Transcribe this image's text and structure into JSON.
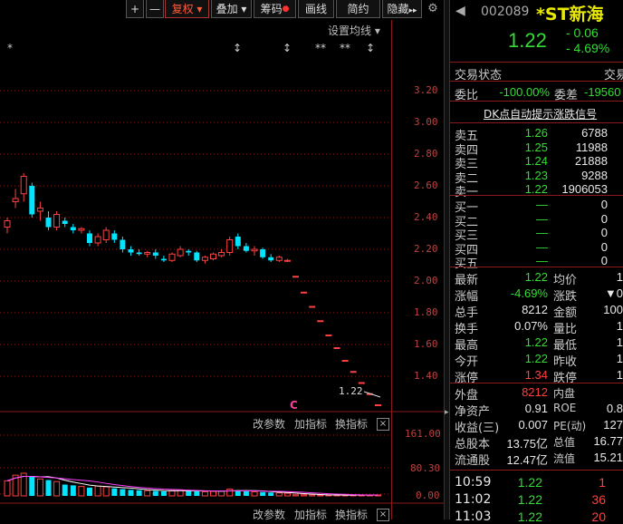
{
  "toolbar": {
    "plus": "+",
    "minus": "—",
    "fuquan": "复权",
    "diejia": "叠加",
    "chouma": "筹码",
    "huaxian": "画线",
    "jianyue": "简约",
    "yincang": "隐藏",
    "arrow": "▸▸"
  },
  "chart": {
    "settings_label": "设置均线",
    "y_ticks": [
      "3.20",
      "3.00",
      "2.80",
      "2.60",
      "2.40",
      "2.20",
      "2.00",
      "1.80",
      "1.60",
      "1.40"
    ],
    "last_price_label": "1.22",
    "marker_c": "C",
    "vol_ticks": [
      "161.00",
      "80.30",
      "0.00"
    ],
    "panel_controls": {
      "change_param": "改参数",
      "add_indicator": "加指标",
      "swap_indicator": "换指标",
      "close": "×"
    },
    "top_marks": [
      "*",
      "↕",
      "↕",
      "**",
      "**",
      "↕"
    ]
  },
  "chart_data": {
    "type": "candlestick",
    "y_range": [
      1.2,
      3.3
    ],
    "candles": [
      {
        "o": 2.34,
        "h": 2.4,
        "l": 2.3,
        "c": 2.38
      },
      {
        "o": 2.5,
        "h": 2.58,
        "l": 2.46,
        "c": 2.52
      },
      {
        "o": 2.55,
        "h": 2.68,
        "l": 2.5,
        "c": 2.66
      },
      {
        "o": 2.6,
        "h": 2.62,
        "l": 2.4,
        "c": 2.42
      },
      {
        "o": 2.44,
        "h": 2.5,
        "l": 2.38,
        "c": 2.46
      },
      {
        "o": 2.4,
        "h": 2.44,
        "l": 2.32,
        "c": 2.34
      },
      {
        "o": 2.34,
        "h": 2.44,
        "l": 2.32,
        "c": 2.42
      },
      {
        "o": 2.38,
        "h": 2.4,
        "l": 2.34,
        "c": 2.36
      },
      {
        "o": 2.34,
        "h": 2.36,
        "l": 2.3,
        "c": 2.32
      },
      {
        "o": 2.32,
        "h": 2.34,
        "l": 2.3,
        "c": 2.33
      },
      {
        "o": 2.3,
        "h": 2.32,
        "l": 2.22,
        "c": 2.24
      },
      {
        "o": 2.24,
        "h": 2.3,
        "l": 2.22,
        "c": 2.28
      },
      {
        "o": 2.26,
        "h": 2.34,
        "l": 2.24,
        "c": 2.32
      },
      {
        "o": 2.3,
        "h": 2.32,
        "l": 2.24,
        "c": 2.26
      },
      {
        "o": 2.26,
        "h": 2.28,
        "l": 2.18,
        "c": 2.2
      },
      {
        "o": 2.2,
        "h": 2.22,
        "l": 2.16,
        "c": 2.18
      },
      {
        "o": 2.18,
        "h": 2.2,
        "l": 2.16,
        "c": 2.17
      },
      {
        "o": 2.17,
        "h": 2.19,
        "l": 2.15,
        "c": 2.18
      },
      {
        "o": 2.18,
        "h": 2.2,
        "l": 2.14,
        "c": 2.16
      },
      {
        "o": 2.14,
        "h": 2.16,
        "l": 2.12,
        "c": 2.13
      },
      {
        "o": 2.13,
        "h": 2.18,
        "l": 2.12,
        "c": 2.17
      },
      {
        "o": 2.16,
        "h": 2.22,
        "l": 2.15,
        "c": 2.2
      },
      {
        "o": 2.19,
        "h": 2.2,
        "l": 2.16,
        "c": 2.18
      },
      {
        "o": 2.18,
        "h": 2.19,
        "l": 2.12,
        "c": 2.13
      },
      {
        "o": 2.13,
        "h": 2.16,
        "l": 2.11,
        "c": 2.15
      },
      {
        "o": 2.14,
        "h": 2.18,
        "l": 2.13,
        "c": 2.17
      },
      {
        "o": 2.16,
        "h": 2.2,
        "l": 2.15,
        "c": 2.18
      },
      {
        "o": 2.18,
        "h": 2.28,
        "l": 2.16,
        "c": 2.26
      },
      {
        "o": 2.28,
        "h": 2.3,
        "l": 2.2,
        "c": 2.22
      },
      {
        "o": 2.22,
        "h": 2.24,
        "l": 2.18,
        "c": 2.19
      },
      {
        "o": 2.19,
        "h": 2.22,
        "l": 2.16,
        "c": 2.2
      },
      {
        "o": 2.2,
        "h": 2.21,
        "l": 2.14,
        "c": 2.15
      },
      {
        "o": 2.15,
        "h": 2.17,
        "l": 2.12,
        "c": 2.13
      },
      {
        "o": 2.13,
        "h": 2.16,
        "l": 2.12,
        "c": 2.15
      },
      {
        "o": 2.13,
        "h": 2.14,
        "l": 2.12,
        "c": 2.13
      },
      {
        "o": 2.03,
        "h": 2.03,
        "l": 2.03,
        "c": 2.03
      },
      {
        "o": 1.93,
        "h": 1.93,
        "l": 1.93,
        "c": 1.93
      },
      {
        "o": 1.84,
        "h": 1.84,
        "l": 1.84,
        "c": 1.84
      },
      {
        "o": 1.75,
        "h": 1.75,
        "l": 1.75,
        "c": 1.75
      },
      {
        "o": 1.66,
        "h": 1.66,
        "l": 1.66,
        "c": 1.66
      },
      {
        "o": 1.58,
        "h": 1.58,
        "l": 1.58,
        "c": 1.58
      },
      {
        "o": 1.5,
        "h": 1.5,
        "l": 1.5,
        "c": 1.5
      },
      {
        "o": 1.43,
        "h": 1.43,
        "l": 1.43,
        "c": 1.43
      },
      {
        "o": 1.36,
        "h": 1.36,
        "l": 1.36,
        "c": 1.36
      },
      {
        "o": 1.29,
        "h": 1.29,
        "l": 1.29,
        "c": 1.29
      },
      {
        "o": 1.22,
        "h": 1.22,
        "l": 1.22,
        "c": 1.22
      }
    ],
    "volume_range": [
      0,
      161.0
    ],
    "volumes": [
      40,
      55,
      60,
      52,
      45,
      42,
      38,
      30,
      28,
      25,
      22,
      26,
      24,
      20,
      18,
      16,
      15,
      14,
      13,
      12,
      14,
      16,
      13,
      12,
      11,
      12,
      13,
      18,
      15,
      12,
      11,
      10,
      9,
      8,
      7,
      3,
      3,
      3,
      2,
      2,
      2,
      2,
      2,
      2,
      2,
      2
    ]
  },
  "stock": {
    "code": "002089",
    "name": "*ST新海",
    "price": "1.22",
    "change": "- 0.06",
    "change_pct": "- 4.69%"
  },
  "status": {
    "label": "交易状态",
    "value": "交易"
  },
  "weibi": {
    "label1": "委比",
    "val1": "-100.00%",
    "label2": "委差",
    "val2": "-19560"
  },
  "dk_signal": "DK点自动提示涨跌信号",
  "asks": [
    {
      "label": "卖五",
      "price": "1.26",
      "vol": "6788"
    },
    {
      "label": "卖四",
      "price": "1.25",
      "vol": "11988"
    },
    {
      "label": "卖三",
      "price": "1.24",
      "vol": "21888"
    },
    {
      "label": "卖二",
      "price": "1.23",
      "vol": "9288"
    },
    {
      "label": "卖一",
      "price": "1.22",
      "vol": "1906053"
    }
  ],
  "bids": [
    {
      "label": "买一",
      "price": "—",
      "vol": "0"
    },
    {
      "label": "买二",
      "price": "—",
      "vol": "0"
    },
    {
      "label": "买三",
      "price": "—",
      "vol": "0"
    },
    {
      "label": "买四",
      "price": "—",
      "vol": "0"
    },
    {
      "label": "买五",
      "price": "—",
      "vol": "0"
    }
  ],
  "stats": [
    {
      "l1": "最新",
      "v1": "1.22",
      "c1": "green",
      "l2": "均价",
      "v2": "1"
    },
    {
      "l1": "涨幅",
      "v1": "-4.69%",
      "c1": "green",
      "l2": "涨跌",
      "v2": "▼0"
    },
    {
      "l1": "总手",
      "v1": "8212",
      "c1": "white",
      "l2": "金额",
      "v2": "100"
    },
    {
      "l1": "换手",
      "v1": "0.07%",
      "c1": "white",
      "l2": "量比",
      "v2": "1"
    },
    {
      "l1": "最高",
      "v1": "1.22",
      "c1": "green",
      "l2": "最低",
      "v2": "1"
    },
    {
      "l1": "今开",
      "v1": "1.22",
      "c1": "green",
      "l2": "昨收",
      "v2": "1"
    },
    {
      "l1": "涨停",
      "v1": "1.34",
      "c1": "red",
      "l2": "跌停",
      "v2": "1"
    }
  ],
  "stats2": [
    {
      "l1": "外盘",
      "v1": "8212",
      "c1": "red",
      "l2": "内盘",
      "v2": ""
    },
    {
      "l1": "净资产",
      "v1": "0.91",
      "c1": "white",
      "l2": "ROE",
      "v2": "0.8"
    },
    {
      "l1": "收益(三)",
      "v1": "0.007",
      "c1": "white",
      "l2": "PE(动)",
      "v2": "127"
    },
    {
      "l1": "总股本",
      "v1": "13.75亿",
      "c1": "white",
      "l2": "总值",
      "v2": "16.77"
    },
    {
      "l1": "流通股",
      "v1": "12.47亿",
      "c1": "white",
      "l2": "流值",
      "v2": "15.21"
    }
  ],
  "ticks": [
    {
      "time": "10:59",
      "price": "1.22",
      "vol": "1"
    },
    {
      "time": "11:02",
      "price": "1.22",
      "vol": "36"
    },
    {
      "time": "11:03",
      "price": "1.22",
      "vol": "20"
    }
  ],
  "colors": {
    "up": "#ff4040",
    "down": "#00e5ff",
    "grid": "#8b1a1a",
    "accent": "#ff5a3c"
  }
}
